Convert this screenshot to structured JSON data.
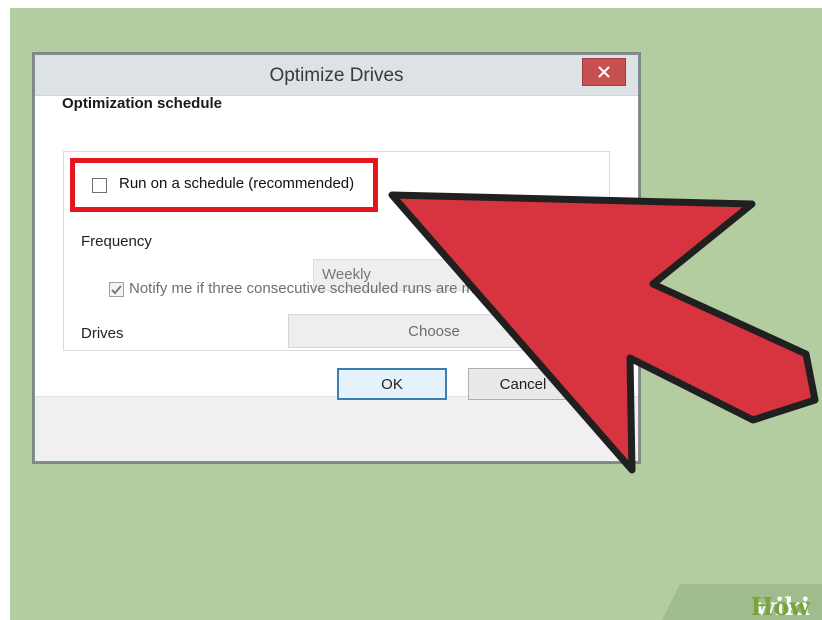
{
  "dialog": {
    "title": "Optimize Drives",
    "close_glyph": "✕",
    "section_title": "Optimization schedule",
    "run_schedule_label": "Run on a schedule (recommended)",
    "run_schedule_checked": false,
    "frequency_label": "Frequency",
    "frequency_value": "Weekly",
    "notify_label": "Notify me if three consecutive scheduled runs are missed",
    "notify_checked": true,
    "drives_label": "Drives",
    "choose_label": "Choose",
    "ok_label": "OK",
    "cancel_label": "Cancel"
  },
  "overlay": {
    "arrow_color": "#d7343f",
    "highlight_color": "#e3161b"
  },
  "watermark": {
    "part1": "wiki",
    "part2": "How"
  }
}
